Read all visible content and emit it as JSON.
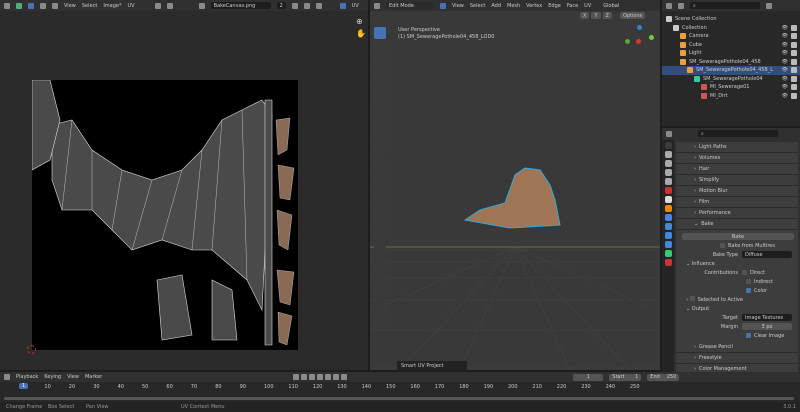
{
  "uv_editor": {
    "menus": [
      "View",
      "Select",
      "Image*",
      "UV"
    ],
    "image_name": "BakeCanvas.png",
    "users": "2",
    "uv_label": "UV"
  },
  "viewport": {
    "mode": "Edit Mode",
    "menus": [
      "View",
      "Select",
      "Add",
      "Mesh",
      "Vertex",
      "Edge",
      "Face",
      "UV"
    ],
    "orientation": "Global",
    "options": "Options",
    "axes": [
      "X",
      "Y",
      "Z"
    ],
    "perspective": "User Perspective",
    "object_info": "(1) SM_SeweragePothole04_458_LOD0",
    "operator_panel": "Smart UV Project"
  },
  "outliner": {
    "items": [
      {
        "label": "Scene Collection",
        "depth": 0,
        "icon": "collection-icon"
      },
      {
        "label": "Collection",
        "depth": 1,
        "icon": "collection-icon"
      },
      {
        "label": "Camera",
        "depth": 2,
        "icon": "camera-icon"
      },
      {
        "label": "Cube",
        "depth": 2,
        "icon": "mesh-icon"
      },
      {
        "label": "Light",
        "depth": 2,
        "icon": "light-icon"
      },
      {
        "label": "SM_SeweragePothole04_458",
        "depth": 2,
        "icon": "empty-icon"
      },
      {
        "label": "SM_SeweragePothole04_458_L",
        "depth": 3,
        "icon": "mesh-icon",
        "selected": true
      },
      {
        "label": "SM_SeweragePothole04",
        "depth": 4,
        "icon": "mesh-data-icon"
      },
      {
        "label": "MI_Sewerage01",
        "depth": 5,
        "icon": "material-icon"
      },
      {
        "label": "MI_Dirt",
        "depth": 5,
        "icon": "material-icon"
      }
    ]
  },
  "properties": {
    "panels_top": [
      "Light Paths",
      "Volumes",
      "Hair",
      "Simplify",
      "Motion Blur",
      "Film",
      "Performance",
      "Bake"
    ],
    "bake_button": "Bake",
    "bake_from_multires": "Bake from Multires",
    "bake_type_label": "Bake Type",
    "bake_type": "Diffuse",
    "influence": "Influence",
    "contributions": "Contributions",
    "direct": "Direct",
    "indirect": "Indirect",
    "color": "Color",
    "selected_to_active": "Selected to Active",
    "output": "Output",
    "target_label": "Target",
    "target": "Image Textures",
    "margin_label": "Margin",
    "margin": "3 px",
    "clear_image": "Clear Image",
    "panels_bottom": [
      "Grease Pencil",
      "Freestyle",
      "Color Management"
    ]
  },
  "timeline": {
    "menus": [
      "Playback",
      "Keying",
      "View",
      "Marker"
    ],
    "current_frame": "1",
    "start_label": "Start",
    "start": "1",
    "end_label": "End",
    "end": "250",
    "ticks": [
      "0",
      "10",
      "20",
      "30",
      "40",
      "50",
      "60",
      "70",
      "80",
      "90",
      "100",
      "110",
      "120",
      "130",
      "140",
      "150",
      "160",
      "170",
      "180",
      "190",
      "200",
      "210",
      "220",
      "230",
      "240",
      "250"
    ]
  },
  "status": {
    "items": [
      "Change Frame",
      "Box Select",
      "Pan View",
      "UV Context Menu"
    ],
    "version": "3.0.1"
  },
  "colors": {
    "accent": "#4772b3",
    "selected_row": "#334d80",
    "bg": "#303030",
    "grid": "#3a3a3a"
  }
}
